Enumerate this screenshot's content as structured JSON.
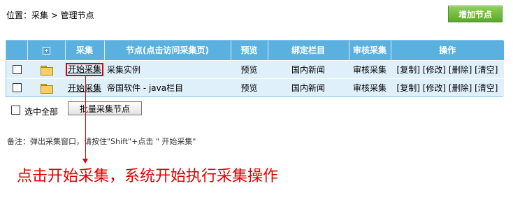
{
  "breadcrumb": "位置：采集 > 管理节点",
  "add_button": "增加节点",
  "table": {
    "columns": [
      "",
      "+",
      "采集",
      "节点(点击访问采集页)",
      "预览",
      "绑定栏目",
      "审核采集",
      "操作"
    ],
    "rows": [
      {
        "collect_link": "开始采集",
        "node": "采集实例",
        "preview": "预览",
        "column": "国内新闻",
        "review": "审核采集",
        "actions": "[复制] [修改] [删除] [清空]"
      },
      {
        "collect_link": "开始采集",
        "node": "帝国软件 - java栏目",
        "preview": "预览",
        "column": "国内新闻",
        "review": "审核采集",
        "actions": "[复制] [修改] [删除] [清空]"
      }
    ]
  },
  "select_all_label": "选中全部",
  "batch_button": "批量采集节点",
  "note": "备注：弹出采集窗口，请按住\"Shift\"+点击 \" 开始采集\"",
  "annotation": "点击开始采集，系统开始执行采集操作",
  "colors": {
    "header_bg": "#5ab1df",
    "row_bg": "#dff0fb",
    "accent_green": "#6abb3a",
    "annotation_red": "#e00000"
  },
  "icons": [
    "expand-icon",
    "folder-icon"
  ]
}
